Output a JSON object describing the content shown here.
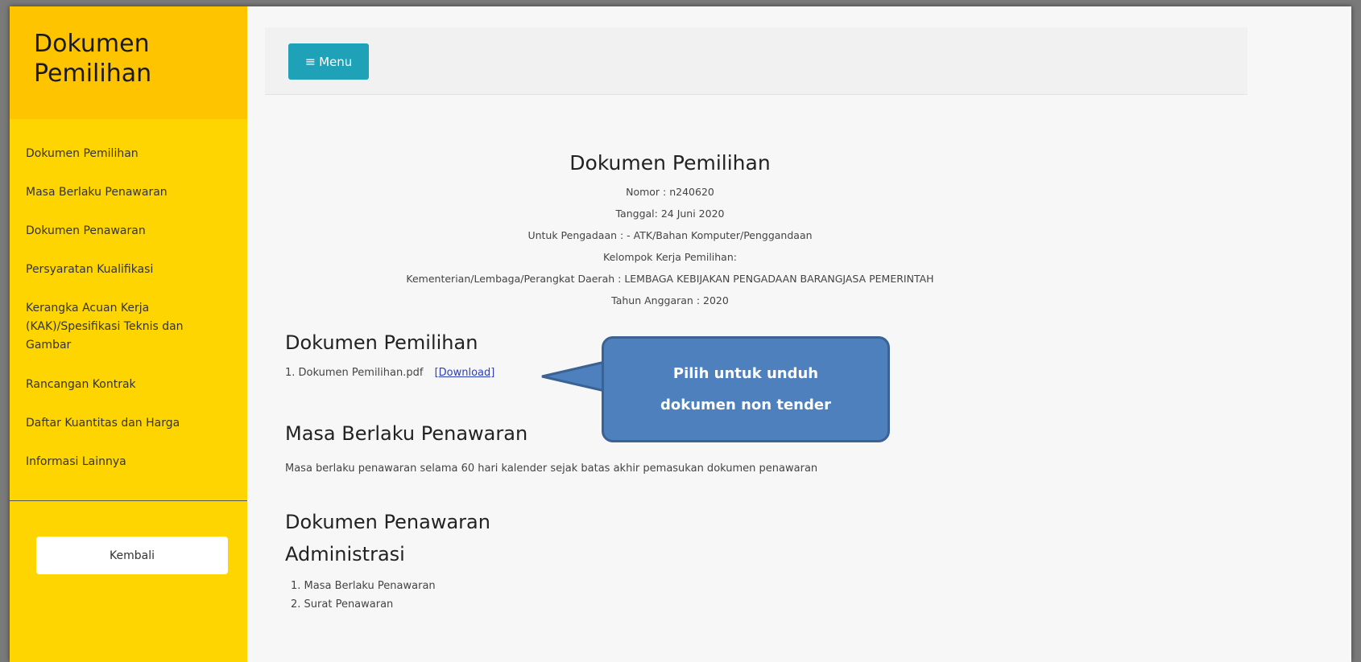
{
  "sidebar": {
    "title_line1": "Dokumen",
    "title_line2": "Pemilihan",
    "items": [
      {
        "label": "Dokumen Pemilihan"
      },
      {
        "label": "Masa Berlaku Penawaran"
      },
      {
        "label": "Dokumen Penawaran"
      },
      {
        "label": "Persyaratan Kualifikasi"
      },
      {
        "label": "Kerangka Acuan Kerja (KAK)/Spesifikasi Teknis dan Gambar"
      },
      {
        "label": "Rancangan Kontrak"
      },
      {
        "label": "Daftar Kuantitas dan Harga"
      },
      {
        "label": "Informasi Lainnya"
      }
    ],
    "back_label": "Kembali"
  },
  "topbar": {
    "menu_label": "Menu",
    "menu_icon": "menu-icon"
  },
  "document": {
    "title": "Dokumen Pemilihan",
    "nomor": "Nomor : n240620",
    "tanggal": "Tanggal: 24 Juni 2020",
    "pengadaan": "Untuk Pengadaan : - ATK/Bahan Komputer/Penggandaan",
    "kelompok": "Kelompok Kerja Pemilihan:",
    "instansi": "Kementerian/Lembaga/Perangkat Daerah : LEMBAGA KEBIJAKAN PENGADAAN BARANGJASA PEMERINTAH",
    "tahun": "Tahun Anggaran : 2020"
  },
  "sections": {
    "pemilihan": {
      "title": "Dokumen Pemilihan",
      "file": "1. Dokumen Pemilihan.pdf",
      "download": "[Download]"
    },
    "masa": {
      "title": "Masa Berlaku Penawaran",
      "text": "Masa berlaku penawaran selama 60 hari kalender sejak batas akhir pemasukan dokumen penawaran"
    },
    "penawaran": {
      "title": "Dokumen Penawaran",
      "subtitle": "Administrasi",
      "items": [
        "1. Masa Berlaku Penawaran",
        "2. Surat Penawaran"
      ]
    }
  },
  "callout": {
    "line1": "Pilih untuk unduh",
    "line2": "dokumen non tender",
    "color": "#4e80be"
  },
  "colors": {
    "sidebar": "#ffd500",
    "sidebar_header": "#ffc400",
    "menu_button": "#1fa2b8",
    "link": "#2d3fb8"
  }
}
